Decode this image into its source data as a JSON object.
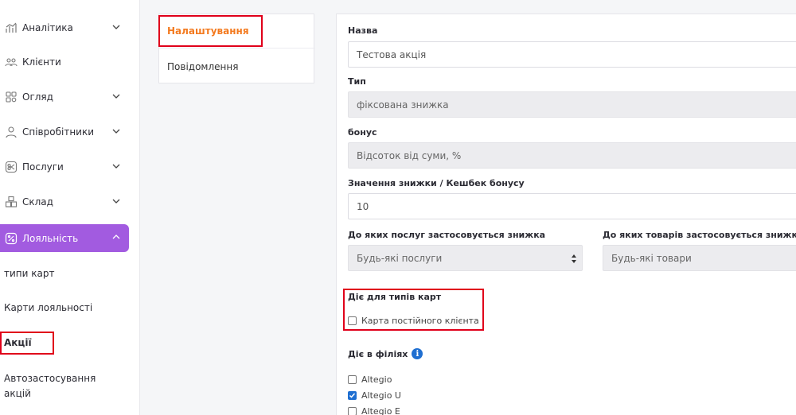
{
  "sidebar": {
    "items": [
      {
        "label": "Аналітика",
        "icon": "analytics-icon"
      },
      {
        "label": "Клієнти",
        "icon": "clients-icon"
      },
      {
        "label": "Огляд",
        "icon": "overview-icon"
      },
      {
        "label": "Співробітники",
        "icon": "employees-icon"
      },
      {
        "label": "Послуги",
        "icon": "services-icon"
      },
      {
        "label": "Склад",
        "icon": "warehouse-icon"
      },
      {
        "label": "Лояльність",
        "icon": "loyalty-icon"
      }
    ],
    "sub_items": [
      {
        "label": "типи карт"
      },
      {
        "label": "Карти лояльності"
      },
      {
        "label": "Акції"
      },
      {
        "label": "Автозастосування акцій"
      }
    ],
    "accent_color": "#a25be0"
  },
  "tabs": {
    "active": "Налаштування",
    "other": "Повідомлення",
    "active_color": "#f37a1f"
  },
  "form": {
    "name": {
      "label": "Назва",
      "value": "Тестова акція"
    },
    "type": {
      "label": "Тип",
      "value": "фіксована знижка"
    },
    "bonus": {
      "label": "бонус",
      "value": "Відсоток від суми, %"
    },
    "discount": {
      "label": "Значення знижки / Кешбек бонусу",
      "value": "10"
    },
    "services": {
      "label": "До яких послуг застосовується знижка",
      "value": "Будь-які послуги"
    },
    "goods": {
      "label": "До яких товарів застосовується знижка",
      "value": "Будь-які товари"
    },
    "card_types": {
      "label": "Діє для типів карт",
      "option": "Карта постійного клієнта"
    },
    "branches": {
      "label": "Діє в філіях",
      "options": [
        {
          "label": "Altegio",
          "checked": false
        },
        {
          "label": "Altegio U",
          "checked": true
        },
        {
          "label": "Altegio E",
          "checked": false
        }
      ]
    }
  }
}
